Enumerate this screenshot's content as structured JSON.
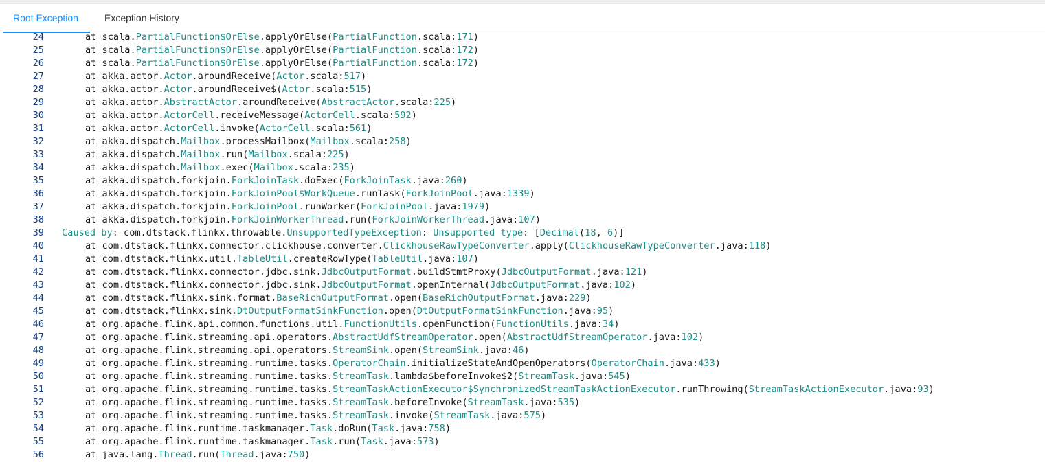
{
  "tabs": [
    {
      "label": "Root Exception",
      "active": true
    },
    {
      "label": "Exception History",
      "active": false
    }
  ],
  "colors": {
    "accent": "#1890ff",
    "class_token": "#1b8a85",
    "line_number": "#0b3f8a"
  },
  "lines": [
    {
      "n": "24",
      "indent": true,
      "segs": [
        [
          "t",
          "at scala."
        ],
        [
          "c",
          "PartialFunction$OrElse"
        ],
        [
          "t",
          ".applyOrElse("
        ],
        [
          "c",
          "PartialFunction"
        ],
        [
          "t",
          ".scala:"
        ],
        [
          "c",
          "171"
        ],
        [
          "t",
          ")"
        ]
      ]
    },
    {
      "n": "25",
      "indent": true,
      "segs": [
        [
          "t",
          "at scala."
        ],
        [
          "c",
          "PartialFunction$OrElse"
        ],
        [
          "t",
          ".applyOrElse("
        ],
        [
          "c",
          "PartialFunction"
        ],
        [
          "t",
          ".scala:"
        ],
        [
          "c",
          "172"
        ],
        [
          "t",
          ")"
        ]
      ]
    },
    {
      "n": "26",
      "indent": true,
      "segs": [
        [
          "t",
          "at scala."
        ],
        [
          "c",
          "PartialFunction$OrElse"
        ],
        [
          "t",
          ".applyOrElse("
        ],
        [
          "c",
          "PartialFunction"
        ],
        [
          "t",
          ".scala:"
        ],
        [
          "c",
          "172"
        ],
        [
          "t",
          ")"
        ]
      ]
    },
    {
      "n": "27",
      "indent": true,
      "segs": [
        [
          "t",
          "at akka.actor."
        ],
        [
          "c",
          "Actor"
        ],
        [
          "t",
          ".aroundReceive("
        ],
        [
          "c",
          "Actor"
        ],
        [
          "t",
          ".scala:"
        ],
        [
          "c",
          "517"
        ],
        [
          "t",
          ")"
        ]
      ]
    },
    {
      "n": "28",
      "indent": true,
      "segs": [
        [
          "t",
          "at akka.actor."
        ],
        [
          "c",
          "Actor"
        ],
        [
          "t",
          ".aroundReceive$("
        ],
        [
          "c",
          "Actor"
        ],
        [
          "t",
          ".scala:"
        ],
        [
          "c",
          "515"
        ],
        [
          "t",
          ")"
        ]
      ]
    },
    {
      "n": "29",
      "indent": true,
      "segs": [
        [
          "t",
          "at akka.actor."
        ],
        [
          "c",
          "AbstractActor"
        ],
        [
          "t",
          ".aroundReceive("
        ],
        [
          "c",
          "AbstractActor"
        ],
        [
          "t",
          ".scala:"
        ],
        [
          "c",
          "225"
        ],
        [
          "t",
          ")"
        ]
      ]
    },
    {
      "n": "30",
      "indent": true,
      "segs": [
        [
          "t",
          "at akka.actor."
        ],
        [
          "c",
          "ActorCell"
        ],
        [
          "t",
          ".receiveMessage("
        ],
        [
          "c",
          "ActorCell"
        ],
        [
          "t",
          ".scala:"
        ],
        [
          "c",
          "592"
        ],
        [
          "t",
          ")"
        ]
      ]
    },
    {
      "n": "31",
      "indent": true,
      "segs": [
        [
          "t",
          "at akka.actor."
        ],
        [
          "c",
          "ActorCell"
        ],
        [
          "t",
          ".invoke("
        ],
        [
          "c",
          "ActorCell"
        ],
        [
          "t",
          ".scala:"
        ],
        [
          "c",
          "561"
        ],
        [
          "t",
          ")"
        ]
      ]
    },
    {
      "n": "32",
      "indent": true,
      "segs": [
        [
          "t",
          "at akka.dispatch."
        ],
        [
          "c",
          "Mailbox"
        ],
        [
          "t",
          ".processMailbox("
        ],
        [
          "c",
          "Mailbox"
        ],
        [
          "t",
          ".scala:"
        ],
        [
          "c",
          "258"
        ],
        [
          "t",
          ")"
        ]
      ]
    },
    {
      "n": "33",
      "indent": true,
      "segs": [
        [
          "t",
          "at akka.dispatch."
        ],
        [
          "c",
          "Mailbox"
        ],
        [
          "t",
          ".run("
        ],
        [
          "c",
          "Mailbox"
        ],
        [
          "t",
          ".scala:"
        ],
        [
          "c",
          "225"
        ],
        [
          "t",
          ")"
        ]
      ]
    },
    {
      "n": "34",
      "indent": true,
      "segs": [
        [
          "t",
          "at akka.dispatch."
        ],
        [
          "c",
          "Mailbox"
        ],
        [
          "t",
          ".exec("
        ],
        [
          "c",
          "Mailbox"
        ],
        [
          "t",
          ".scala:"
        ],
        [
          "c",
          "235"
        ],
        [
          "t",
          ")"
        ]
      ]
    },
    {
      "n": "35",
      "indent": true,
      "segs": [
        [
          "t",
          "at akka.dispatch.forkjoin."
        ],
        [
          "c",
          "ForkJoinTask"
        ],
        [
          "t",
          ".doExec("
        ],
        [
          "c",
          "ForkJoinTask"
        ],
        [
          "t",
          ".java:"
        ],
        [
          "c",
          "260"
        ],
        [
          "t",
          ")"
        ]
      ]
    },
    {
      "n": "36",
      "indent": true,
      "segs": [
        [
          "t",
          "at akka.dispatch.forkjoin."
        ],
        [
          "c",
          "ForkJoinPool$WorkQueue"
        ],
        [
          "t",
          ".runTask("
        ],
        [
          "c",
          "ForkJoinPool"
        ],
        [
          "t",
          ".java:"
        ],
        [
          "c",
          "1339"
        ],
        [
          "t",
          ")"
        ]
      ]
    },
    {
      "n": "37",
      "indent": true,
      "segs": [
        [
          "t",
          "at akka.dispatch.forkjoin."
        ],
        [
          "c",
          "ForkJoinPool"
        ],
        [
          "t",
          ".runWorker("
        ],
        [
          "c",
          "ForkJoinPool"
        ],
        [
          "t",
          ".java:"
        ],
        [
          "c",
          "1979"
        ],
        [
          "t",
          ")"
        ]
      ]
    },
    {
      "n": "38",
      "indent": true,
      "segs": [
        [
          "t",
          "at akka.dispatch.forkjoin."
        ],
        [
          "c",
          "ForkJoinWorkerThread"
        ],
        [
          "t",
          ".run("
        ],
        [
          "c",
          "ForkJoinWorkerThread"
        ],
        [
          "t",
          ".java:"
        ],
        [
          "c",
          "107"
        ],
        [
          "t",
          ")"
        ]
      ]
    },
    {
      "n": "39",
      "indent": false,
      "segs": [
        [
          "c",
          "Caused by"
        ],
        [
          "t",
          ": com.dtstack.flinkx.throwable."
        ],
        [
          "c",
          "UnsupportedTypeException"
        ],
        [
          "t",
          ": "
        ],
        [
          "c",
          "Unsupported type"
        ],
        [
          "t",
          ": ["
        ],
        [
          "c",
          "Decimal"
        ],
        [
          "t",
          "("
        ],
        [
          "c",
          "18"
        ],
        [
          "t",
          ", "
        ],
        [
          "c",
          "6"
        ],
        [
          "t",
          ")]"
        ]
      ]
    },
    {
      "n": "40",
      "indent": true,
      "segs": [
        [
          "t",
          "at com.dtstack.flinkx.connector.clickhouse.converter."
        ],
        [
          "c",
          "ClickhouseRawTypeConverter"
        ],
        [
          "t",
          ".apply("
        ],
        [
          "c",
          "ClickhouseRawTypeConverter"
        ],
        [
          "t",
          ".java:"
        ],
        [
          "c",
          "118"
        ],
        [
          "t",
          ")"
        ]
      ]
    },
    {
      "n": "41",
      "indent": true,
      "segs": [
        [
          "t",
          "at com.dtstack.flinkx.util."
        ],
        [
          "c",
          "TableUtil"
        ],
        [
          "t",
          ".createRowType("
        ],
        [
          "c",
          "TableUtil"
        ],
        [
          "t",
          ".java:"
        ],
        [
          "c",
          "107"
        ],
        [
          "t",
          ")"
        ]
      ]
    },
    {
      "n": "42",
      "indent": true,
      "segs": [
        [
          "t",
          "at com.dtstack.flinkx.connector.jdbc.sink."
        ],
        [
          "c",
          "JdbcOutputFormat"
        ],
        [
          "t",
          ".buildStmtProxy("
        ],
        [
          "c",
          "JdbcOutputFormat"
        ],
        [
          "t",
          ".java:"
        ],
        [
          "c",
          "121"
        ],
        [
          "t",
          ")"
        ]
      ]
    },
    {
      "n": "43",
      "indent": true,
      "segs": [
        [
          "t",
          "at com.dtstack.flinkx.connector.jdbc.sink."
        ],
        [
          "c",
          "JdbcOutputFormat"
        ],
        [
          "t",
          ".openInternal("
        ],
        [
          "c",
          "JdbcOutputFormat"
        ],
        [
          "t",
          ".java:"
        ],
        [
          "c",
          "102"
        ],
        [
          "t",
          ")"
        ]
      ]
    },
    {
      "n": "44",
      "indent": true,
      "segs": [
        [
          "t",
          "at com.dtstack.flinkx.sink.format."
        ],
        [
          "c",
          "BaseRichOutputFormat"
        ],
        [
          "t",
          ".open("
        ],
        [
          "c",
          "BaseRichOutputFormat"
        ],
        [
          "t",
          ".java:"
        ],
        [
          "c",
          "229"
        ],
        [
          "t",
          ")"
        ]
      ]
    },
    {
      "n": "45",
      "indent": true,
      "segs": [
        [
          "t",
          "at com.dtstack.flinkx.sink."
        ],
        [
          "c",
          "DtOutputFormatSinkFunction"
        ],
        [
          "t",
          ".open("
        ],
        [
          "c",
          "DtOutputFormatSinkFunction"
        ],
        [
          "t",
          ".java:"
        ],
        [
          "c",
          "95"
        ],
        [
          "t",
          ")"
        ]
      ]
    },
    {
      "n": "46",
      "indent": true,
      "segs": [
        [
          "t",
          "at org.apache.flink.api.common.functions.util."
        ],
        [
          "c",
          "FunctionUtils"
        ],
        [
          "t",
          ".openFunction("
        ],
        [
          "c",
          "FunctionUtils"
        ],
        [
          "t",
          ".java:"
        ],
        [
          "c",
          "34"
        ],
        [
          "t",
          ")"
        ]
      ]
    },
    {
      "n": "47",
      "indent": true,
      "segs": [
        [
          "t",
          "at org.apache.flink.streaming.api.operators."
        ],
        [
          "c",
          "AbstractUdfStreamOperator"
        ],
        [
          "t",
          ".open("
        ],
        [
          "c",
          "AbstractUdfStreamOperator"
        ],
        [
          "t",
          ".java:"
        ],
        [
          "c",
          "102"
        ],
        [
          "t",
          ")"
        ]
      ]
    },
    {
      "n": "48",
      "indent": true,
      "segs": [
        [
          "t",
          "at org.apache.flink.streaming.api.operators."
        ],
        [
          "c",
          "StreamSink"
        ],
        [
          "t",
          ".open("
        ],
        [
          "c",
          "StreamSink"
        ],
        [
          "t",
          ".java:"
        ],
        [
          "c",
          "46"
        ],
        [
          "t",
          ")"
        ]
      ]
    },
    {
      "n": "49",
      "indent": true,
      "segs": [
        [
          "t",
          "at org.apache.flink.streaming.runtime.tasks."
        ],
        [
          "c",
          "OperatorChain"
        ],
        [
          "t",
          ".initializeStateAndOpenOperators("
        ],
        [
          "c",
          "OperatorChain"
        ],
        [
          "t",
          ".java:"
        ],
        [
          "c",
          "433"
        ],
        [
          "t",
          ")"
        ]
      ]
    },
    {
      "n": "50",
      "indent": true,
      "segs": [
        [
          "t",
          "at org.apache.flink.streaming.runtime.tasks."
        ],
        [
          "c",
          "StreamTask"
        ],
        [
          "t",
          ".lambda$beforeInvoke$2("
        ],
        [
          "c",
          "StreamTask"
        ],
        [
          "t",
          ".java:"
        ],
        [
          "c",
          "545"
        ],
        [
          "t",
          ")"
        ]
      ]
    },
    {
      "n": "51",
      "indent": true,
      "segs": [
        [
          "t",
          "at org.apache.flink.streaming.runtime.tasks."
        ],
        [
          "c",
          "StreamTaskActionExecutor$SynchronizedStreamTaskActionExecutor"
        ],
        [
          "t",
          ".runThrowing("
        ],
        [
          "c",
          "StreamTaskActionExecutor"
        ],
        [
          "t",
          ".java:"
        ],
        [
          "c",
          "93"
        ],
        [
          "t",
          ")"
        ]
      ]
    },
    {
      "n": "52",
      "indent": true,
      "segs": [
        [
          "t",
          "at org.apache.flink.streaming.runtime.tasks."
        ],
        [
          "c",
          "StreamTask"
        ],
        [
          "t",
          ".beforeInvoke("
        ],
        [
          "c",
          "StreamTask"
        ],
        [
          "t",
          ".java:"
        ],
        [
          "c",
          "535"
        ],
        [
          "t",
          ")"
        ]
      ]
    },
    {
      "n": "53",
      "indent": true,
      "segs": [
        [
          "t",
          "at org.apache.flink.streaming.runtime.tasks."
        ],
        [
          "c",
          "StreamTask"
        ],
        [
          "t",
          ".invoke("
        ],
        [
          "c",
          "StreamTask"
        ],
        [
          "t",
          ".java:"
        ],
        [
          "c",
          "575"
        ],
        [
          "t",
          ")"
        ]
      ]
    },
    {
      "n": "54",
      "indent": true,
      "segs": [
        [
          "t",
          "at org.apache.flink.runtime.taskmanager."
        ],
        [
          "c",
          "Task"
        ],
        [
          "t",
          ".doRun("
        ],
        [
          "c",
          "Task"
        ],
        [
          "t",
          ".java:"
        ],
        [
          "c",
          "758"
        ],
        [
          "t",
          ")"
        ]
      ]
    },
    {
      "n": "55",
      "indent": true,
      "segs": [
        [
          "t",
          "at org.apache.flink.runtime.taskmanager."
        ],
        [
          "c",
          "Task"
        ],
        [
          "t",
          ".run("
        ],
        [
          "c",
          "Task"
        ],
        [
          "t",
          ".java:"
        ],
        [
          "c",
          "573"
        ],
        [
          "t",
          ")"
        ]
      ]
    },
    {
      "n": "56",
      "indent": true,
      "segs": [
        [
          "t",
          "at java.lang."
        ],
        [
          "c",
          "Thread"
        ],
        [
          "t",
          ".run("
        ],
        [
          "c",
          "Thread"
        ],
        [
          "t",
          ".java:"
        ],
        [
          "c",
          "750"
        ],
        [
          "t",
          ")"
        ]
      ]
    }
  ]
}
